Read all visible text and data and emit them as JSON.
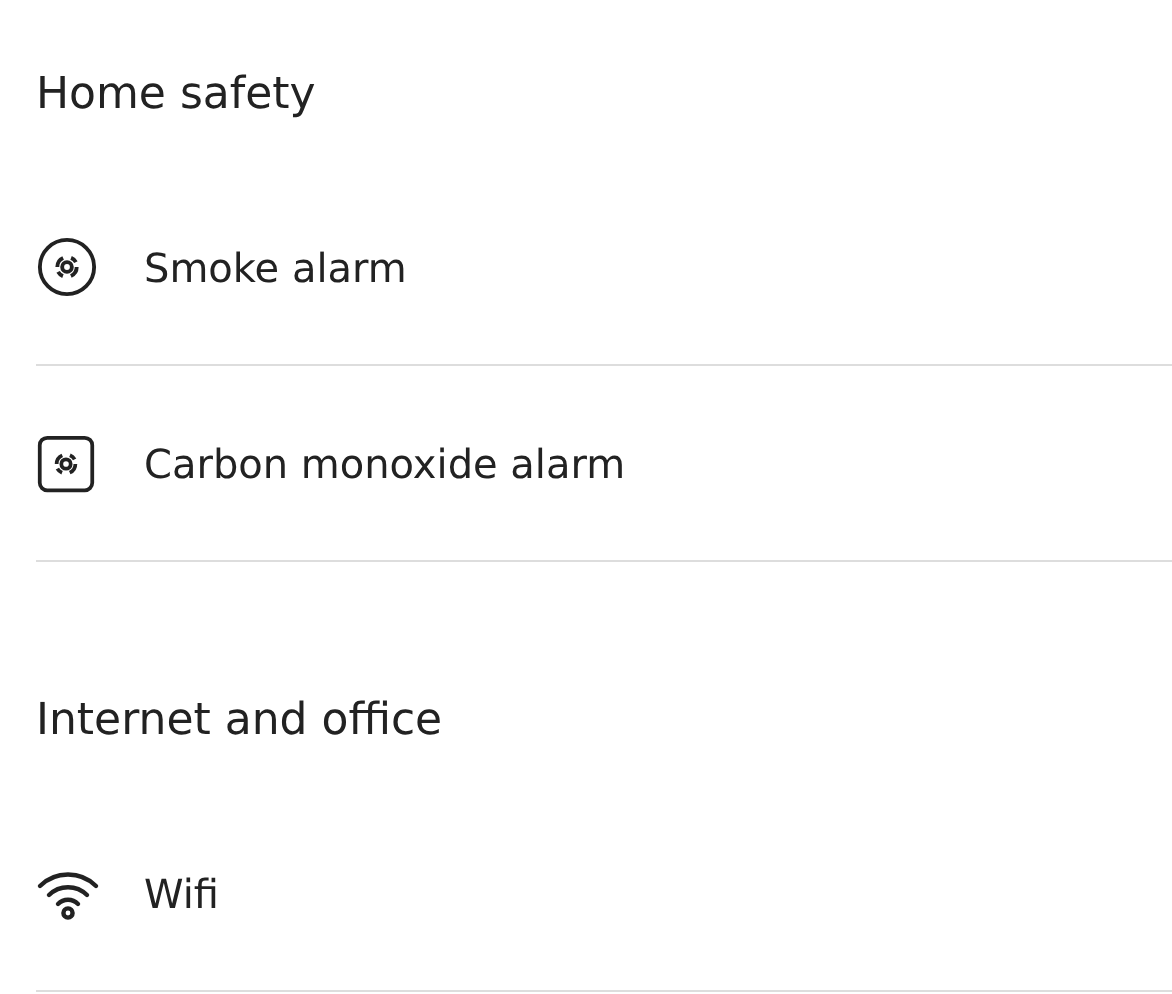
{
  "sections": [
    {
      "title": "Home safety",
      "items": [
        {
          "kind": "smoke",
          "label": "Smoke alarm"
        },
        {
          "kind": "co",
          "label": "Carbon monoxide alarm"
        }
      ]
    },
    {
      "title": "Internet and office",
      "items": [
        {
          "kind": "wifi",
          "label": "Wifi"
        }
      ]
    }
  ]
}
